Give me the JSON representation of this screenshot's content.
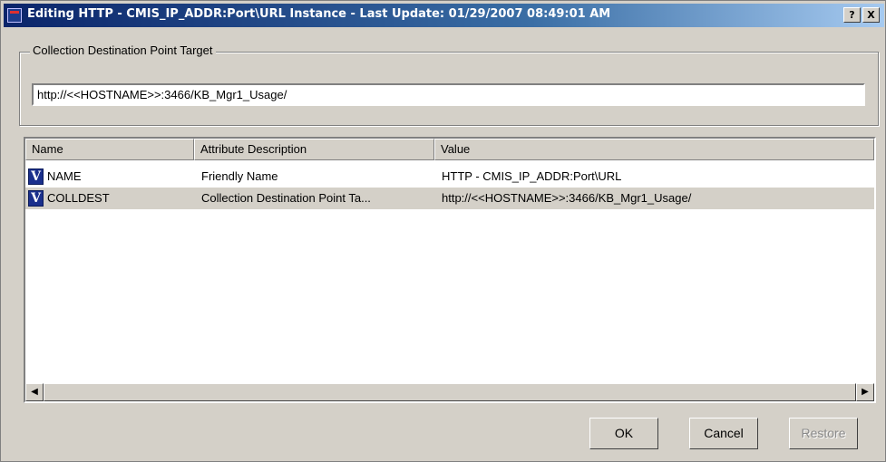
{
  "window": {
    "title": "Editing HTTP - CMIS_IP_ADDR:Port\\URL Instance - Last Update: 01/29/2007 08:49:01 AM",
    "help_label": "?",
    "close_label": "X"
  },
  "group": {
    "label": "Collection Destination Point Target",
    "url_value": "http://<<HOSTNAME>>:3466/KB_Mgr1_Usage/"
  },
  "table": {
    "columns": [
      "Name",
      "Attribute Description",
      "Value"
    ],
    "rows": [
      {
        "icon": "V",
        "name": "NAME",
        "description": "Friendly Name",
        "value": "HTTP - CMIS_IP_ADDR:Port\\URL"
      },
      {
        "icon": "V",
        "name": "COLLDEST",
        "description": "Collection Destination Point Ta...",
        "value": "http://<<HOSTNAME>>:3466/KB_Mgr1_Usage/"
      }
    ],
    "scroll_left": "◀",
    "scroll_right": "▶"
  },
  "buttons": {
    "ok": "OK",
    "cancel": "Cancel",
    "restore": "Restore"
  },
  "colors": {
    "titlebar_start": "#0a246a",
    "titlebar_end": "#a6caf0",
    "dialog_bg": "#d4d0c8",
    "variable_icon": "#1a2f8c"
  },
  "icons": {
    "app": "app-icon",
    "row": "variable-icon"
  }
}
